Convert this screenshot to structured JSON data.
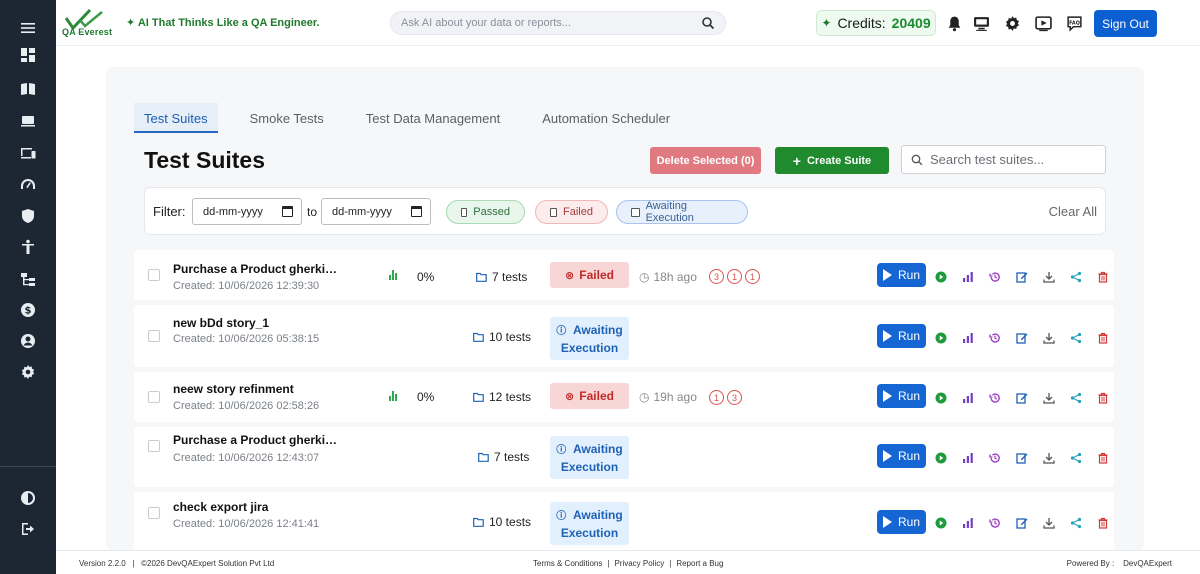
{
  "sidebar": {
    "icons": [
      "menu-icon",
      "dashboard-icon",
      "book-icon",
      "monitor-icon",
      "devices-icon",
      "speedometer-icon",
      "shield-icon",
      "accessibility-icon",
      "tree-icon",
      "dollar-icon",
      "user-circle-icon",
      "gear-icon",
      "half-circle-icon",
      "logout-icon"
    ]
  },
  "header": {
    "logo_text": "QA Everest",
    "tagline": "✦ AI That Thinks Like a QA Engineer.",
    "ai_search_placeholder": "Ask AI about your data or reports...",
    "credits_label": "Credits:",
    "credits_value": "20409",
    "signout_label": "Sign Out"
  },
  "tabs": [
    {
      "label": "Test Suites",
      "active": true
    },
    {
      "label": "Smoke Tests",
      "active": false
    },
    {
      "label": "Test Data Management",
      "active": false
    },
    {
      "label": "Automation Scheduler",
      "active": false
    }
  ],
  "main": {
    "title": "Test Suites",
    "delete_selected_label": "Delete Selected (0)",
    "create_suite_label": "Create Suite",
    "search_placeholder": "Search test suites..."
  },
  "filter": {
    "label": "Filter:",
    "from_placeholder": "dd-mm-yyyy",
    "to_label": "to",
    "to_placeholder": "dd-mm-yyyy",
    "chip_passed": "Passed",
    "chip_failed": "Failed",
    "chip_awaiting": "Awaiting Execution",
    "clear_all": "Clear All"
  },
  "rows": [
    {
      "name": "Purchase a Product gherki…",
      "created": "Created: 10/06/2026 12:39:30",
      "pct": "0%",
      "tests": "7 tests",
      "status": "Failed",
      "ago": "18h ago",
      "circles": [
        "3",
        "1",
        "1"
      ]
    },
    {
      "name": "new bDd story_1",
      "created": "Created: 10/06/2026 05:38:15",
      "tests": "10 tests",
      "status_line1": "Awaiting",
      "status_line2": "Execution"
    },
    {
      "name": "neew story refinment",
      "created": "Created: 10/06/2026 02:58:26",
      "pct": "0%",
      "tests": "12 tests",
      "status": "Failed",
      "ago": "19h ago",
      "circles": [
        "1",
        "3"
      ]
    },
    {
      "name": "Purchase a Product gherki…",
      "created": "Created: 10/06/2026 12:43:07",
      "tests": "7 tests",
      "status_line1": "Awaiting",
      "status_line2": "Execution"
    },
    {
      "name": "check export jira",
      "created": "Created: 10/06/2026 12:41:41",
      "tests": "10 tests",
      "status_line1": "Awaiting",
      "status_line2": "Execution"
    }
  ],
  "run_label": "Run",
  "footer": {
    "version": "Version 2.2.0",
    "copyright": "©2026 DevQAExpert Solution Pvt Ltd",
    "terms": "Terms & Conditions",
    "privacy": "Privacy Policy",
    "report_bug": "Report a Bug",
    "powered_by_label": "Powered By :",
    "powered_by": "DevQAExpert"
  },
  "colors": {
    "sidebar_bg": "#1c2733",
    "primary_blue": "#1565d3",
    "create_green": "#1f8a2e",
    "credits_green": "#1a8a2f",
    "failed_red": "#c02a2a",
    "awaiting_blue": "#1e62b6"
  }
}
